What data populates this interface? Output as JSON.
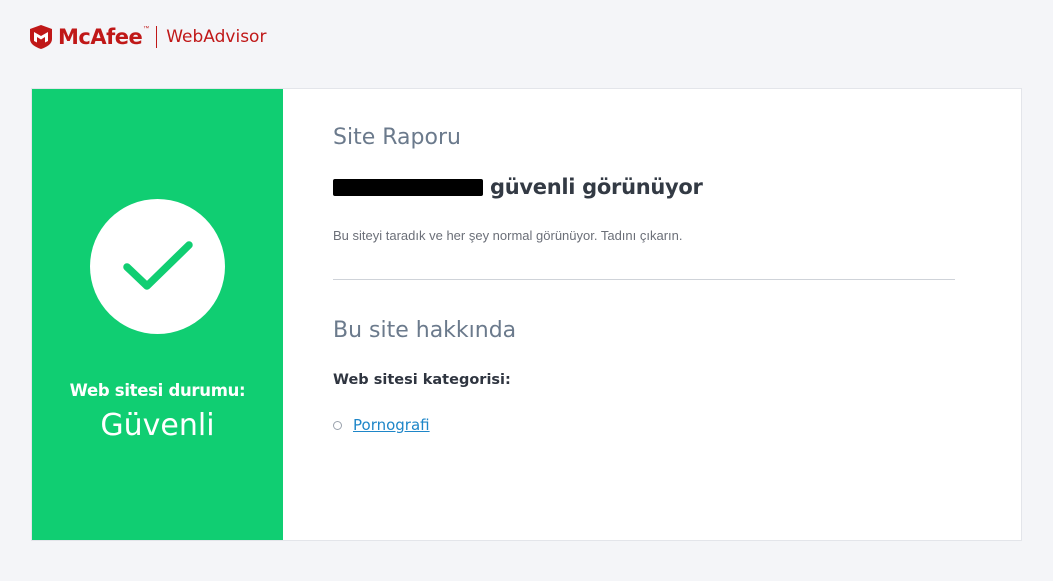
{
  "header": {
    "brand": "McAfee",
    "trademark": "™",
    "product": "WebAdvisor"
  },
  "status_panel": {
    "label": "Web sitesi durumu:",
    "value": "Güvenli",
    "icon": "checkmark-icon",
    "color": "#10ce72"
  },
  "report": {
    "title": "Site Raporu",
    "site_status": "güvenli görünüyor",
    "description": "Bu siteyi taradık ve her şey normal görünüyor. Tadını çıkarın."
  },
  "about": {
    "title": "Bu site hakkında",
    "category_label": "Web sitesi kategorisi:",
    "categories": [
      "Pornografi"
    ]
  },
  "colors": {
    "brand": "#c01818",
    "safe": "#10ce72",
    "link": "#1e86c8"
  }
}
